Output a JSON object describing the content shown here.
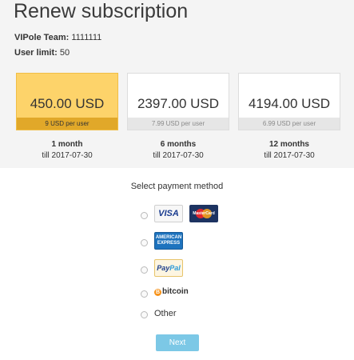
{
  "page": {
    "title": "Renew subscription",
    "team_label": "VIPole Team:",
    "team_value": "1111111",
    "limit_label": "User limit:",
    "limit_value": "50"
  },
  "plans": [
    {
      "price": "450.00 USD",
      "per_user": "9 USD per user",
      "duration": "1 month",
      "till": "till 2017-07-30",
      "selected": true
    },
    {
      "price": "2397.00 USD",
      "per_user": "7.99 USD per user",
      "duration": "6 months",
      "till": "till 2017-07-30",
      "selected": false
    },
    {
      "price": "4194.00 USD",
      "per_user": "6.99 USD per user",
      "duration": "12 months",
      "till": "till 2017-07-30",
      "selected": false
    }
  ],
  "payment": {
    "title": "Select payment method",
    "methods": [
      {
        "id": "cards",
        "logos": [
          "VISA",
          "MasterCard"
        ]
      },
      {
        "id": "amex",
        "logo_text": "AMERICAN EXPRESS"
      },
      {
        "id": "paypal",
        "logo_text_1": "Pay",
        "logo_text_2": "Pal"
      },
      {
        "id": "bitcoin",
        "logo_text": "bitcoin",
        "symbol": "B"
      },
      {
        "id": "other",
        "label": "Other"
      }
    ]
  },
  "actions": {
    "next_label": "Next"
  },
  "colors": {
    "selected_plan": "#fdd36a",
    "selected_plan_bar": "#e1a829",
    "next_button": "#7cc8e6"
  }
}
